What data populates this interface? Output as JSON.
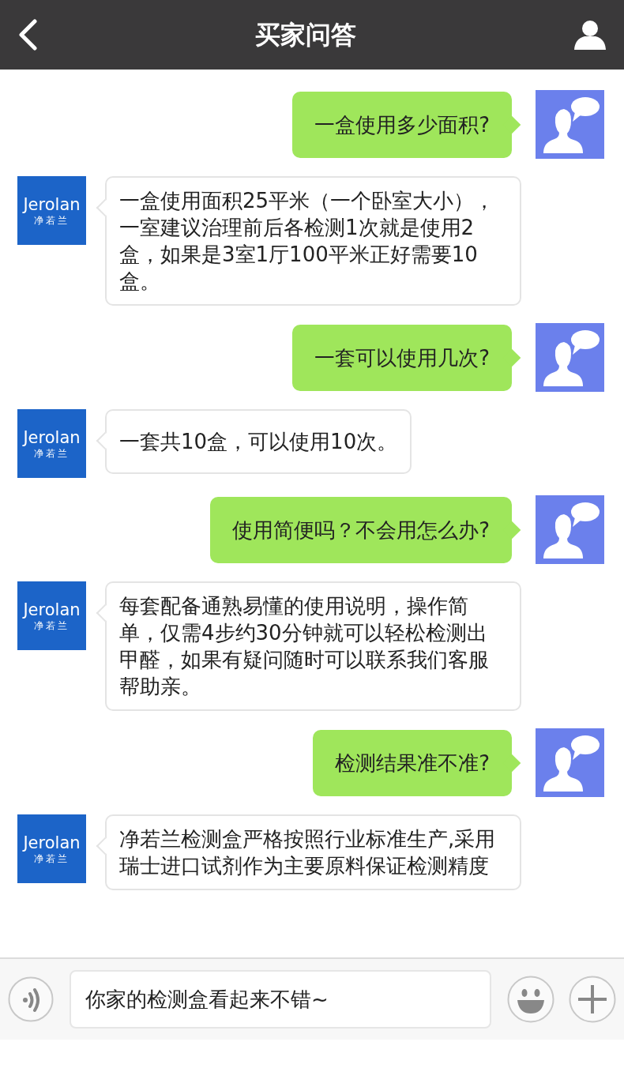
{
  "header": {
    "title": "买家问答"
  },
  "messages": [
    {
      "kind": "question",
      "text": "一盒使用多少面积?"
    },
    {
      "kind": "answer",
      "logo_text": "Jerolan",
      "logo_subtext": "净若兰",
      "text": "一盒使用面积25平米（一个卧室大小），一室建议治理前后各检测1次就是使用2盒，如果是3室1厅100平米正好需要10盒。"
    },
    {
      "kind": "question",
      "text": "一套可以使用几次?"
    },
    {
      "kind": "answer",
      "logo_text": "Jerolan",
      "logo_subtext": "净若兰",
      "text": "一套共10盒，可以使用10次。"
    },
    {
      "kind": "question",
      "text": "使用简便吗？不会用怎么办?"
    },
    {
      "kind": "answer",
      "logo_text": "Jerolan",
      "logo_subtext": "净若兰",
      "text": "每套配备通熟易懂的使用说明，操作简单，仅需4步约30分钟就可以轻松检测出甲醛，如果有疑问随时可以联系我们客服帮助亲。"
    },
    {
      "kind": "question",
      "text": "检测结果准不准?"
    },
    {
      "kind": "answer",
      "logo_text": "Jerolan",
      "logo_subtext": "净若兰",
      "text": "净若兰检测盒严格按照行业标准生产,采用瑞士进口试剂作为主要原料保证检测精度"
    }
  ],
  "composer": {
    "value": "你家的检测盒看起来不错~"
  }
}
